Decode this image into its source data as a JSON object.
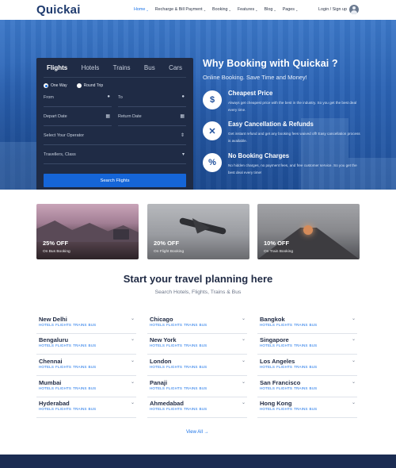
{
  "brand": {
    "logo": "Quickai",
    "accent": "#1a73e8",
    "navy": "#1f2a44"
  },
  "nav": {
    "items": [
      {
        "label": "Home",
        "caret": "⌄",
        "active": true
      },
      {
        "label": "Recharge & Bill Payment",
        "caret": "⌄"
      },
      {
        "label": "Booking",
        "caret": "⌄"
      },
      {
        "label": "Features",
        "caret": "⌄"
      },
      {
        "label": "Blog",
        "caret": "⌄"
      },
      {
        "label": "Pages",
        "caret": "⌄"
      }
    ],
    "auth": "Login / Sign up"
  },
  "search": {
    "tabs": [
      "Flights",
      "Hotels",
      "Trains",
      "Bus",
      "Cars"
    ],
    "trip_types": [
      "One Way",
      "Round Trip"
    ],
    "from_placeholder": "From",
    "to_placeholder": "To",
    "depart_placeholder": "Depart Date",
    "return_placeholder": "Return Date",
    "operator_placeholder": "Select Your Operator",
    "travellers_value": "Travellers, Class",
    "submit": "Search Flights"
  },
  "why": {
    "title": "Why Booking with Quickai ?",
    "subtitle": "Online Booking. Save Time and Money!",
    "features": [
      {
        "icon": "$",
        "title": "Cheapest Price",
        "desc": "Always get cheapest price with the best in the industry. So you get the best deal every time."
      },
      {
        "icon": "✕",
        "title": "Easy Cancellation & Refunds",
        "desc": "Get instant refund and get any booking fees waived off! Easy cancellation process is available."
      },
      {
        "icon": "%",
        "title": "No Booking Charges",
        "desc": "No hidden charges, no payment fees, and free customer service. So you get the best deal every time!"
      }
    ]
  },
  "offers": [
    {
      "percent": "25% OFF",
      "label": "On Bus Booking"
    },
    {
      "percent": "20% OFF",
      "label": "On Flight Booking"
    },
    {
      "percent": "10% OFF",
      "label": "On Train Booking"
    }
  ],
  "planning": {
    "title": "Start your travel planning here",
    "subtitle": "Search Hotels, Flights, Trains & Bus",
    "tags": [
      "HOTELS",
      "FLIGHTS",
      "TRAINS",
      "BUS"
    ],
    "cities": [
      "New Delhi",
      "Chicago",
      "Bangkok",
      "Bengaluru",
      "New York",
      "Singapore",
      "Chennai",
      "London",
      "Los Angeles",
      "Mumbai",
      "Panaji",
      "San Francisco",
      "Hyderabad",
      "Ahmedabad",
      "Hong Kong"
    ],
    "view_all": "View All",
    "view_all_icon": "→"
  }
}
